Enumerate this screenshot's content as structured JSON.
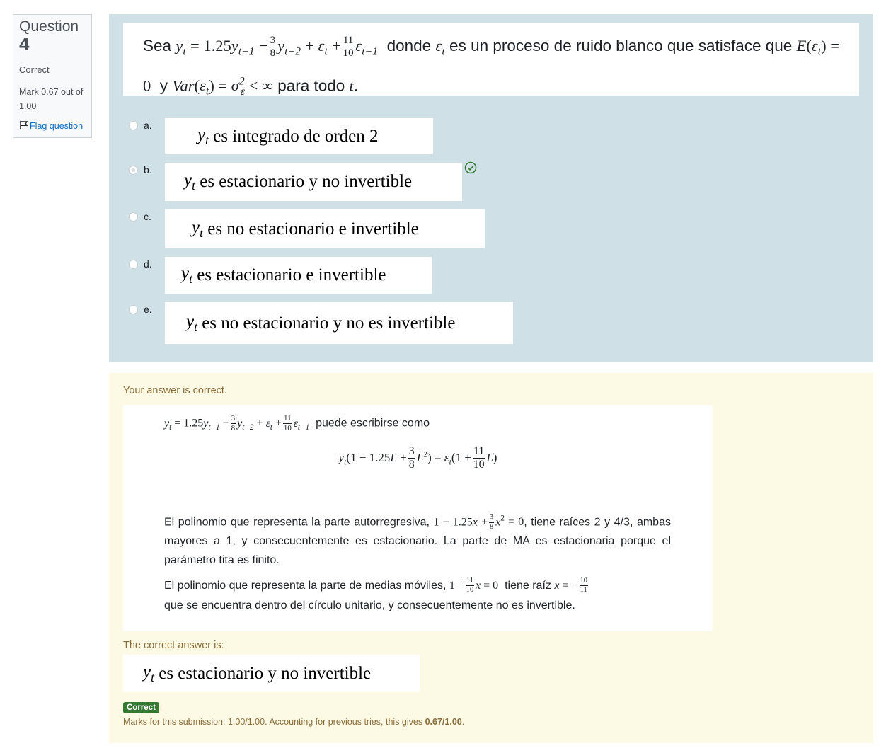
{
  "info": {
    "question_word": "Question",
    "question_number": "4",
    "state": "Correct",
    "grade_line1": "Mark 0.67 out of",
    "grade_line2": "1.00",
    "flag_label": "Flag question",
    "flag_icon": "flag-icon"
  },
  "question": {
    "p1": "Sea",
    "eq": "= 1.25",
    "dn1": "donde",
    "dn2": "es un proceso de ruido blanco que",
    "p2": "satisface que",
    "p3": "y",
    "p4": "para todo",
    "frac1_num": "3",
    "frac1_den": "8",
    "frac2_num": "11",
    "frac2_den": "10"
  },
  "options": [
    {
      "letter": "a.",
      "text": "es integrado de orden 2",
      "selected": false
    },
    {
      "letter": "b.",
      "text": "es estacionario y no invertible",
      "selected": true
    },
    {
      "letter": "c.",
      "text": "es no estacionario e invertible",
      "selected": false
    },
    {
      "letter": "d.",
      "text": "es estacionario e invertible",
      "selected": false
    },
    {
      "letter": "e.",
      "text": "es no estacionario y no es invertible",
      "selected": false
    }
  ],
  "check_icon": "check-circle-icon",
  "feedback": {
    "title": "Your answer is correct.",
    "line1_suffix": "puede escribirse como",
    "p1_a": "El polinomio que representa la parte autorregresiva,",
    "p1_b": ", tiene raíces 2 y 4/3, ambas mayores a 1, y consecuentemente es estacionario. La parte de MA es estacionaria porque el parámetro tita es finito.",
    "p2_a": "El polinomio que representa la parte de medias móviles,",
    "p2_b": "tiene raíz",
    "p2_c": "que se encuentra dentro del círculo unitario, y consecuentemente no es invertible."
  },
  "correct_answer_label": "The correct answer is:",
  "correct_answer_text": "es estacionario y no invertible",
  "grading": {
    "badge": "Correct",
    "marks_prefix": "Marks for this submission: 1.00/1.00. Accounting for previous tries, this gives",
    "marks_value": "0.67/1.00",
    "marks_suffix": "."
  },
  "colors": {
    "formulation_bg": "#cfe1e6",
    "feedback_bg": "#fcf9e4",
    "feedback_text": "#8a6d3b",
    "correct_green": "#357a32",
    "link_blue": "#0f6cbf"
  }
}
